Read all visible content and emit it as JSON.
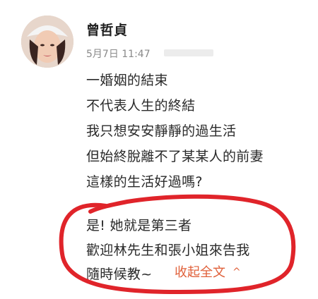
{
  "post": {
    "author": "曾哲貞",
    "timestamp": "5月7日 11:47",
    "lines": [
      "一婚姻的結束",
      "不代表人生的終結",
      "我只想安安靜靜的過生活",
      "但始終脫離不了某某人的前妻",
      "這樣的生活好過嗎?",
      "是! 她就是第三者",
      "歡迎林先生和張小姐來告我",
      "隨時候教~"
    ],
    "collapse_label": "收起全文",
    "collapse_icon": "chevron-up-icon"
  },
  "colors": {
    "annotation_circle": "#e0242a",
    "collapse_link": "#e0603a",
    "timestamp": "#8a8a8a"
  }
}
